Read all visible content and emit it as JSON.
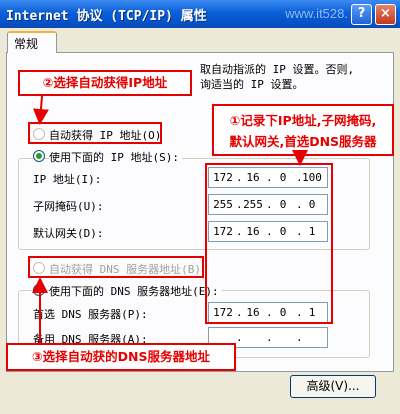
{
  "window": {
    "title": "Internet 协议 (TCP/IP) 属性",
    "watermark": "www.it528.",
    "help_label": "?",
    "close_label": "×"
  },
  "tabs": [
    {
      "label": "常规"
    }
  ],
  "description": "取自动指派的 IP 设置。否则,\n询适当的 IP 设置。",
  "ip_section": {
    "auto_label": "自动获得 IP 地址(O)",
    "manual_label": "使用下面的 IP 地址(S):",
    "fields": [
      {
        "label": "IP 地址(I):",
        "octets": [
          "172",
          "16",
          "0",
          "100"
        ]
      },
      {
        "label": "子网掩码(U):",
        "octets": [
          "255",
          "255",
          "0",
          "0"
        ]
      },
      {
        "label": "默认网关(D):",
        "octets": [
          "172",
          "16",
          "0",
          "1"
        ]
      }
    ]
  },
  "dns_section": {
    "auto_label": "自动获得 DNS 服务器地址(B)",
    "manual_label": "使用下面的 DNS 服务器地址(E):",
    "preferred_label": "首选 DNS 服务器(P):",
    "preferred_octets": [
      "172",
      "16",
      "0",
      "1"
    ],
    "alternate_label": "备用 DNS 服务器(A):",
    "alternate_octets": [
      "",
      "",
      "",
      ""
    ]
  },
  "buttons": {
    "advanced_label": "高级(V)..."
  },
  "annotations": {
    "step2": "②选择自动获得IP地址",
    "step1_line1": "①记录下IP地址,子网掩码,",
    "step1_line2": "默认网关,首选DNS服务器",
    "step3": "③选择自动获的DNS服务器地址"
  },
  "colors": {
    "annotation_red": "#e60000",
    "title_blue": "#0a5fd8",
    "radio_green": "#21a121"
  }
}
